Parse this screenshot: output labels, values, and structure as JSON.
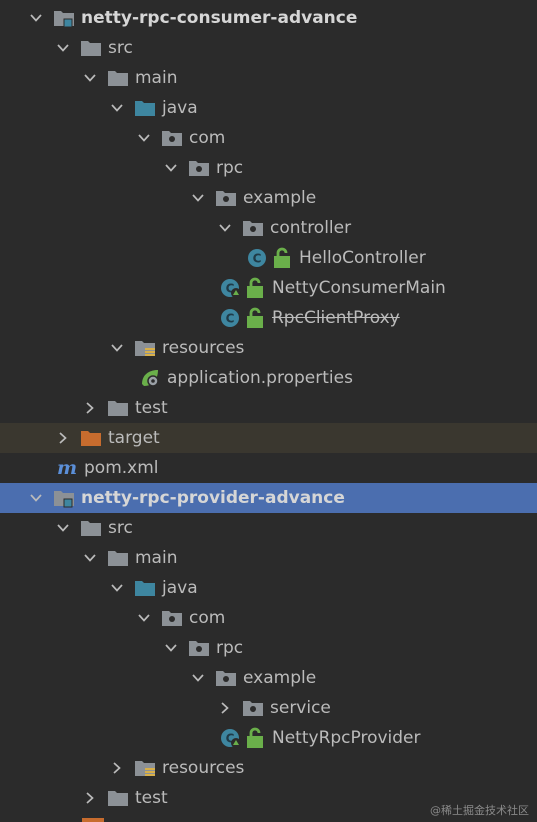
{
  "colors": {
    "background": "#2b2b2b",
    "selected_row": "#4b6eaf",
    "excluded_row": "#3a372f",
    "folder": "#8c9196",
    "source_folder": "#3e86a0",
    "excluded_folder": "#c76c2e",
    "class_circle": "#3e86a0",
    "lock": "#6aaf4a",
    "maven": "#5b8fd8"
  },
  "tree": [
    {
      "id": "consumer",
      "label": "netty-rpc-consumer-advance",
      "icon": "module-folder-icon",
      "arrow": "expanded",
      "bold": true
    },
    {
      "id": "c-src",
      "label": "src",
      "icon": "folder-icon",
      "arrow": "expanded"
    },
    {
      "id": "c-main",
      "label": "main",
      "icon": "folder-icon",
      "arrow": "expanded"
    },
    {
      "id": "c-java",
      "label": "java",
      "icon": "source-folder-icon",
      "arrow": "expanded"
    },
    {
      "id": "c-com",
      "label": "com",
      "icon": "package-icon",
      "arrow": "expanded"
    },
    {
      "id": "c-rpc",
      "label": "rpc",
      "icon": "package-icon",
      "arrow": "expanded"
    },
    {
      "id": "c-example",
      "label": "example",
      "icon": "package-icon",
      "arrow": "expanded"
    },
    {
      "id": "c-controller",
      "label": "controller",
      "icon": "package-icon",
      "arrow": "expanded"
    },
    {
      "id": "c-hello",
      "label": "HelloController",
      "icon": "class-icon",
      "arrow": "none"
    },
    {
      "id": "c-consumermain",
      "label": "NettyConsumerMain",
      "icon": "spring-boot-class-icon",
      "arrow": "none"
    },
    {
      "id": "c-proxy",
      "label": "RpcClientProxy",
      "icon": "class-icon",
      "arrow": "none",
      "strike": true
    },
    {
      "id": "c-resources",
      "label": "resources",
      "icon": "resources-folder-icon",
      "arrow": "expanded"
    },
    {
      "id": "c-props",
      "label": "application.properties",
      "icon": "spring-properties-icon",
      "arrow": "none"
    },
    {
      "id": "c-test",
      "label": "test",
      "icon": "folder-icon",
      "arrow": "collapsed"
    },
    {
      "id": "c-target",
      "label": "target",
      "icon": "excluded-folder-icon",
      "arrow": "collapsed",
      "excluded": true
    },
    {
      "id": "c-pom",
      "label": "pom.xml",
      "icon": "maven-icon",
      "arrow": "none"
    },
    {
      "id": "provider",
      "label": "netty-rpc-provider-advance",
      "icon": "module-folder-icon",
      "arrow": "expanded",
      "bold": true,
      "selected": true
    },
    {
      "id": "p-src",
      "label": "src",
      "icon": "folder-icon",
      "arrow": "expanded"
    },
    {
      "id": "p-main",
      "label": "main",
      "icon": "folder-icon",
      "arrow": "expanded"
    },
    {
      "id": "p-java",
      "label": "java",
      "icon": "source-folder-icon",
      "arrow": "expanded"
    },
    {
      "id": "p-com",
      "label": "com",
      "icon": "package-icon",
      "arrow": "expanded"
    },
    {
      "id": "p-rpc",
      "label": "rpc",
      "icon": "package-icon",
      "arrow": "expanded"
    },
    {
      "id": "p-example",
      "label": "example",
      "icon": "package-icon",
      "arrow": "expanded"
    },
    {
      "id": "p-service",
      "label": "service",
      "icon": "package-icon",
      "arrow": "collapsed"
    },
    {
      "id": "p-provider",
      "label": "NettyRpcProvider",
      "icon": "spring-boot-class-icon",
      "arrow": "none"
    },
    {
      "id": "p-resources",
      "label": "resources",
      "icon": "resources-folder-icon",
      "arrow": "collapsed"
    },
    {
      "id": "p-test",
      "label": "test",
      "icon": "folder-icon",
      "arrow": "collapsed"
    }
  ],
  "watermark": "@稀土掘金技术社区"
}
